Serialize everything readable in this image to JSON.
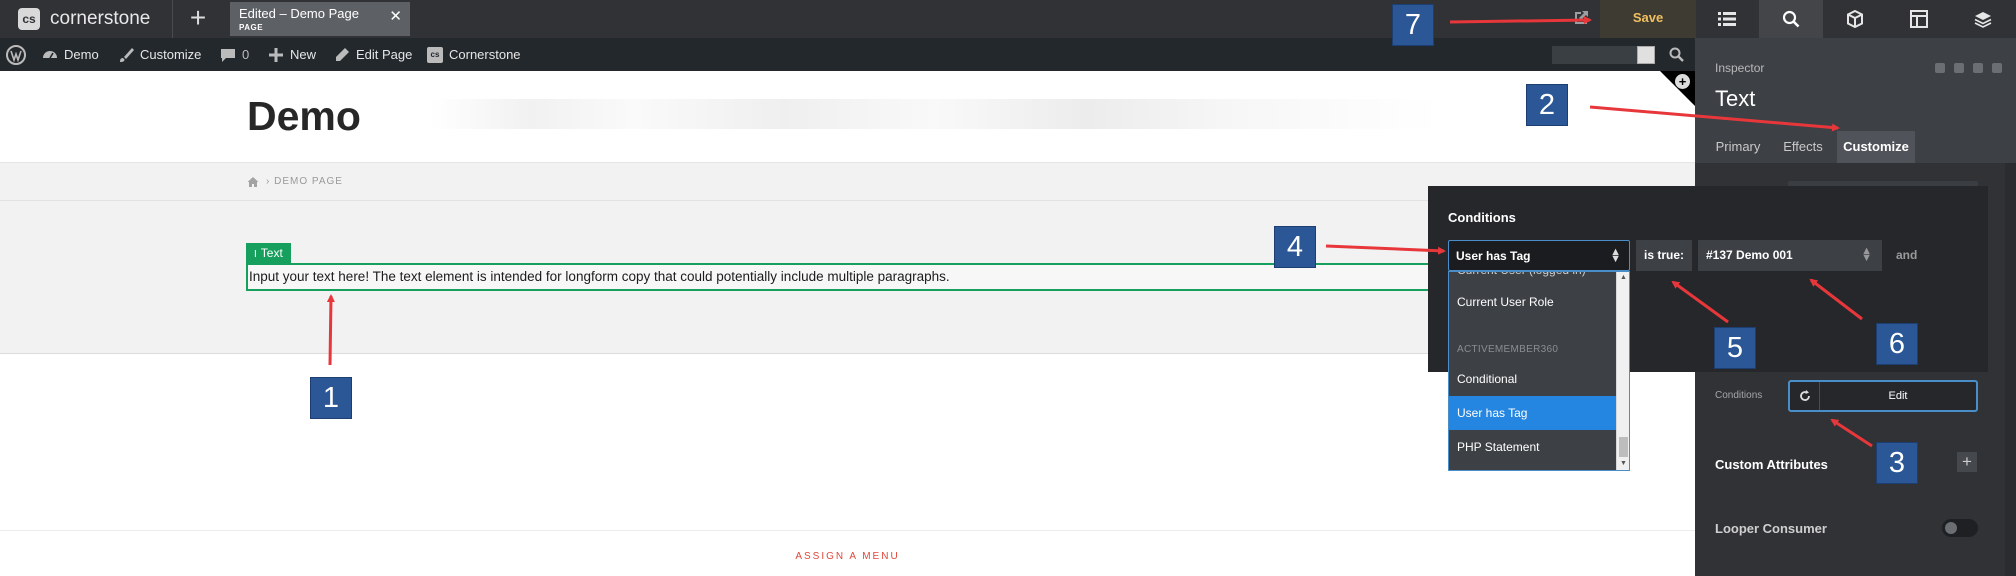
{
  "topbar": {
    "logo_text": "cornerstone",
    "logo_mark": "cs",
    "add_label": "+",
    "doc_tab": {
      "title": "Edited – Demo Page",
      "subtitle": "PAGE",
      "close": "✕"
    },
    "save_label": "Save",
    "tool_icons": [
      "list-icon",
      "search-icon",
      "cube-icon",
      "layout-icon",
      "layers-icon"
    ],
    "active_tool": "search-icon"
  },
  "adminbar": {
    "items": [
      {
        "label": "Demo",
        "icon": "dashboard-icon"
      },
      {
        "label": "Customize",
        "icon": "brush-icon"
      },
      {
        "label": "0",
        "icon": "comment-icon"
      },
      {
        "label": "New",
        "icon": "plus-icon"
      },
      {
        "label": "Edit Page",
        "icon": "pencil-icon"
      },
      {
        "label": "Cornerstone",
        "icon": "cs-icon"
      }
    ]
  },
  "page": {
    "site_title": "Demo",
    "breadcrumb": "› DEMO PAGE",
    "text_element": {
      "tag_label": "Text",
      "content": "Input your text here! The text element is intended for longform copy that could potentially include multiple paragraphs."
    },
    "footer_link": "ASSIGN A MENU"
  },
  "inspector": {
    "label": "Inspector",
    "title": "Text",
    "tabs": [
      "Primary",
      "Effects",
      "Customize"
    ],
    "active_tab": "Customize",
    "conditions_label": "Conditions",
    "conditions_edit": "Edit",
    "custom_attributes": "Custom Attributes",
    "add": "+",
    "looper_consumer": "Looper Consumer"
  },
  "conditions": {
    "title": "Conditions",
    "selected": "User has Tag",
    "operator": "is true:",
    "value": "#137 Demo 001",
    "joiner": "and",
    "dropdown": {
      "cut_item": "Current User (logged in)",
      "items_before": [
        "Current User Role"
      ],
      "group": "ACTIVEMEMBER360",
      "items": [
        "Conditional",
        "User has Tag",
        "PHP Statement"
      ]
    }
  },
  "annotations": [
    "1",
    "2",
    "3",
    "4",
    "5",
    "6",
    "7"
  ],
  "colors": {
    "accent_green": "#17a05d",
    "save_text": "#f0c05e",
    "selection_blue": "#2486e0",
    "annotation_badge": "#2b5797",
    "arrow_red": "#e8373a"
  }
}
